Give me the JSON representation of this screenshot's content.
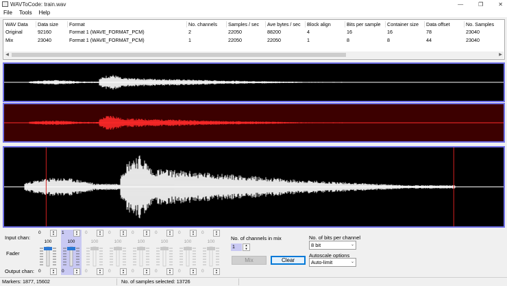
{
  "window": {
    "title": "WAVToCode: train.wav",
    "minimize_glyph": "—",
    "restore_glyph": "❐",
    "close_glyph": "✕"
  },
  "menu": [
    "File",
    "Tools",
    "Help"
  ],
  "table": {
    "headers": [
      "WAV Data",
      "Data size",
      "Format",
      "No. channels",
      "Samples / sec",
      "Ave bytes / sec",
      "Block align",
      "Bits per sample",
      "Container size",
      "Data offset",
      "No. Samples"
    ],
    "rows": [
      [
        "Original",
        "92160",
        "Format 1 (WAVE_FORMAT_PCM)",
        "2",
        "22050",
        "88200",
        "4",
        "16",
        "16",
        "78",
        "23040"
      ],
      [
        "Mix",
        "23040",
        "Format 1 (WAVE_FORMAT_PCM)",
        "1",
        "22050",
        "22050",
        "1",
        "8",
        "8",
        "44",
        "23040"
      ]
    ]
  },
  "waveforms": {
    "top_color": "#ffffff",
    "middle_color": "#ff2a2a",
    "bottom_color": "#ffffff",
    "middle_bg": "#3c0000",
    "marker_color": "#d42020"
  },
  "markers": [
    1877,
    15602
  ],
  "total_samples": 23040,
  "controls": {
    "input_label": "Input chan:",
    "fader_label": "Fader",
    "output_label": "Output chan:",
    "channels": [
      {
        "input": "0",
        "percent": "100",
        "output": "0",
        "enabled": true,
        "selected": false
      },
      {
        "input": "1",
        "percent": "100",
        "output": "0",
        "enabled": true,
        "selected": true
      },
      {
        "input": "0",
        "percent": "100",
        "output": "0",
        "enabled": false,
        "selected": false
      },
      {
        "input": "0",
        "percent": "100",
        "output": "0",
        "enabled": false,
        "selected": false
      },
      {
        "input": "0",
        "percent": "100",
        "output": "0",
        "enabled": false,
        "selected": false
      },
      {
        "input": "0",
        "percent": "100",
        "output": "0",
        "enabled": false,
        "selected": false
      },
      {
        "input": "0",
        "percent": "100",
        "output": "0",
        "enabled": false,
        "selected": false
      },
      {
        "input": "0",
        "percent": "100",
        "output": "0",
        "enabled": false,
        "selected": false
      }
    ],
    "mix_channels_label": "No. of channels in mix",
    "mix_channels_value": "1",
    "mix_button": "Mix",
    "clear_button": "Clear",
    "bits_label": "No. of bits per channel",
    "bits_value": "8 bit",
    "autoscale_label": "Autoscale options",
    "autoscale_value": "Auto-limit"
  },
  "status": {
    "markers": "Markers: 1877, 15602",
    "selected": "No. of samples selected: 13726"
  }
}
